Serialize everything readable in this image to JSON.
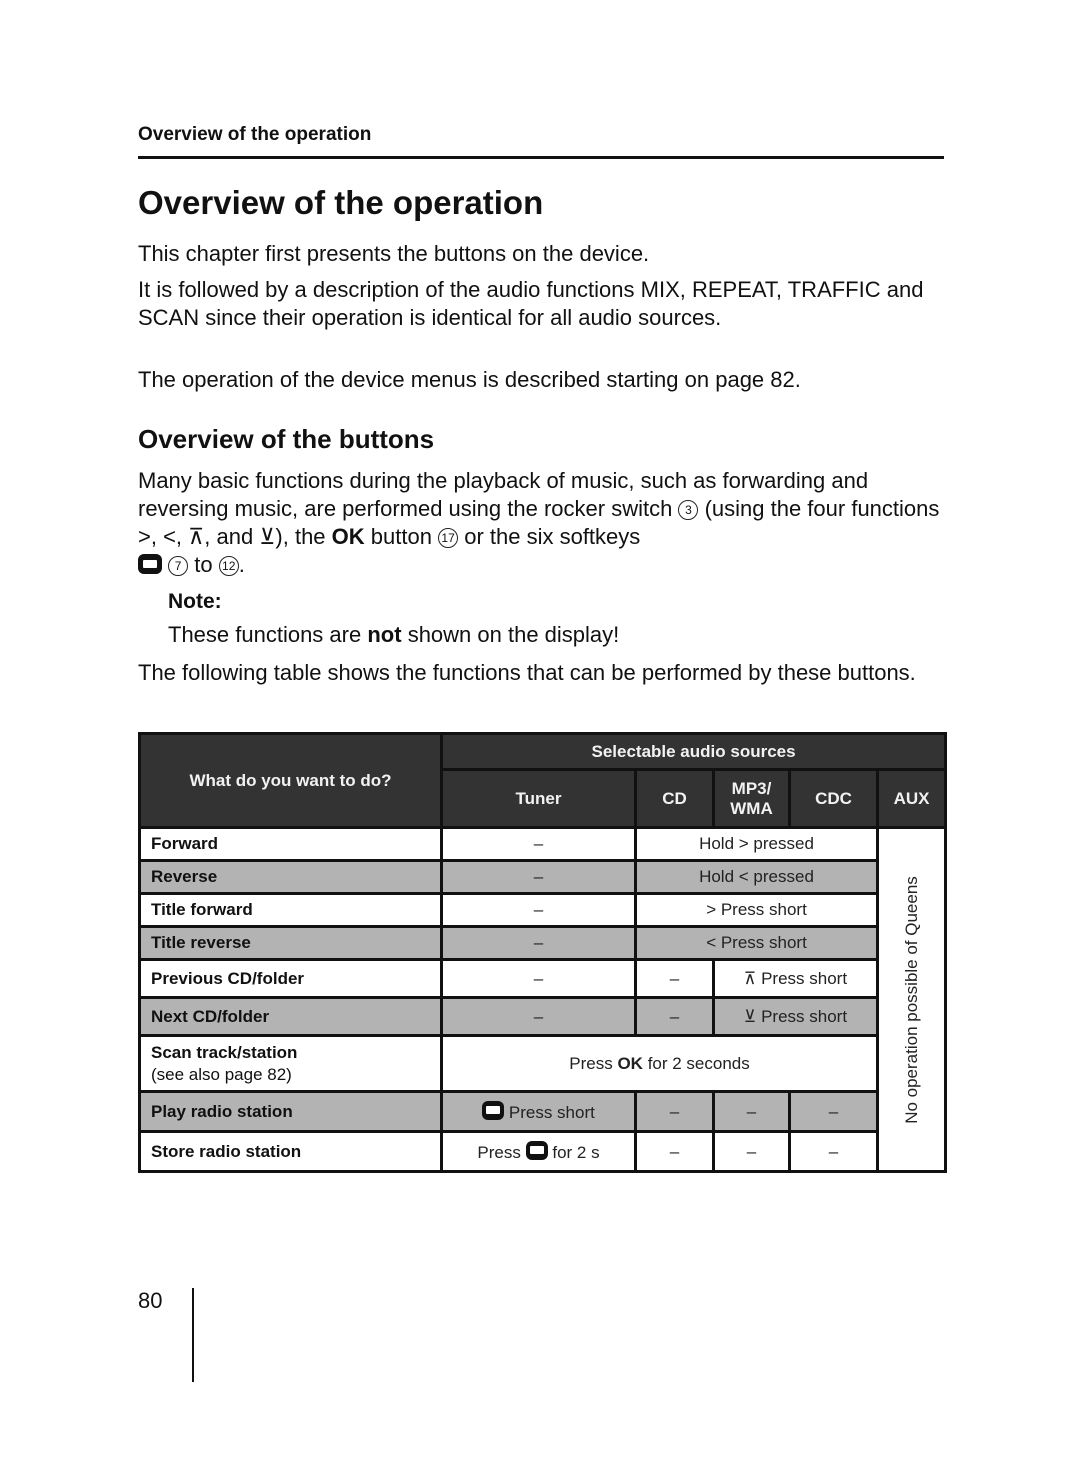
{
  "running_head": "Overview of the operation",
  "title": "Overview of the operation",
  "intro": {
    "p1": "This chapter first presents the buttons on the device.",
    "p2": "It is followed by a description of the audio functions MIX, REPEAT, TRAFFIC and SCAN since their operation is identical for all audio sources.",
    "p3": "The operation of the device menus is described starting on page 82."
  },
  "buttons_section": {
    "heading": "Overview of the buttons",
    "p1_a": "Many basic functions during the playback of music, such as forwarding and reversing music, are performed using the rocker switch",
    "rocker_ref": "3",
    "p1_b": "(using the four functions",
    "functions": ">, <, ⊼, and ⊻",
    "p1_c": "), the",
    "ok_label": "OK",
    "p1_d": "button",
    "ok_ref": "17",
    "p1_e": "or the six softkeys",
    "softkey_from": "7",
    "to_word": "to",
    "softkey_to": "12",
    "note_label": "Note:",
    "note_a": "These functions are",
    "note_bold": "not",
    "note_b": "shown on the display!",
    "p2": "The following table shows the functions that can be performed by these buttons."
  },
  "table": {
    "header_action": "What do you want to do?",
    "header_sources": "Selectable audio sources",
    "sources": [
      "Tuner",
      "CD",
      "MP3/ WMA",
      "CDC",
      "AUX"
    ],
    "aux_note": "No operation possible of Queens",
    "rows": [
      {
        "action": "Forward",
        "tuner": "–",
        "cd_mp3_cdc": "Hold > pressed"
      },
      {
        "action": "Reverse",
        "tuner": "–",
        "cd_mp3_cdc": "Hold < pressed"
      },
      {
        "action": "Title forward",
        "tuner": "–",
        "cd_mp3_cdc": "> Press short"
      },
      {
        "action": "Title reverse",
        "tuner": "–",
        "cd_mp3_cdc": "< Press short"
      },
      {
        "action": "Previous CD/folder",
        "tuner": "–",
        "cd": "–",
        "mp3_cdc": "⊼ Press short"
      },
      {
        "action": "Next CD/folder",
        "tuner": "–",
        "cd": "–",
        "mp3_cdc": "⊻ Press short"
      },
      {
        "action": "Scan track/station",
        "action_sub": "(see also page 82)",
        "all_a": "Press",
        "all_bold": "OK",
        "all_b": "for 2 seconds"
      },
      {
        "action": "Play radio station",
        "tuner_b": "Press short",
        "cd": "–",
        "mp3": "–",
        "cdc": "–"
      },
      {
        "action": "Store radio station",
        "tuner_a": "Press",
        "tuner_b": "for 2 s",
        "cd": "–",
        "mp3": "–",
        "cdc": "–"
      }
    ]
  },
  "page_number": "80",
  "colors": {
    "header_bg": "#333333",
    "gray_row": "#b3b3b3"
  }
}
